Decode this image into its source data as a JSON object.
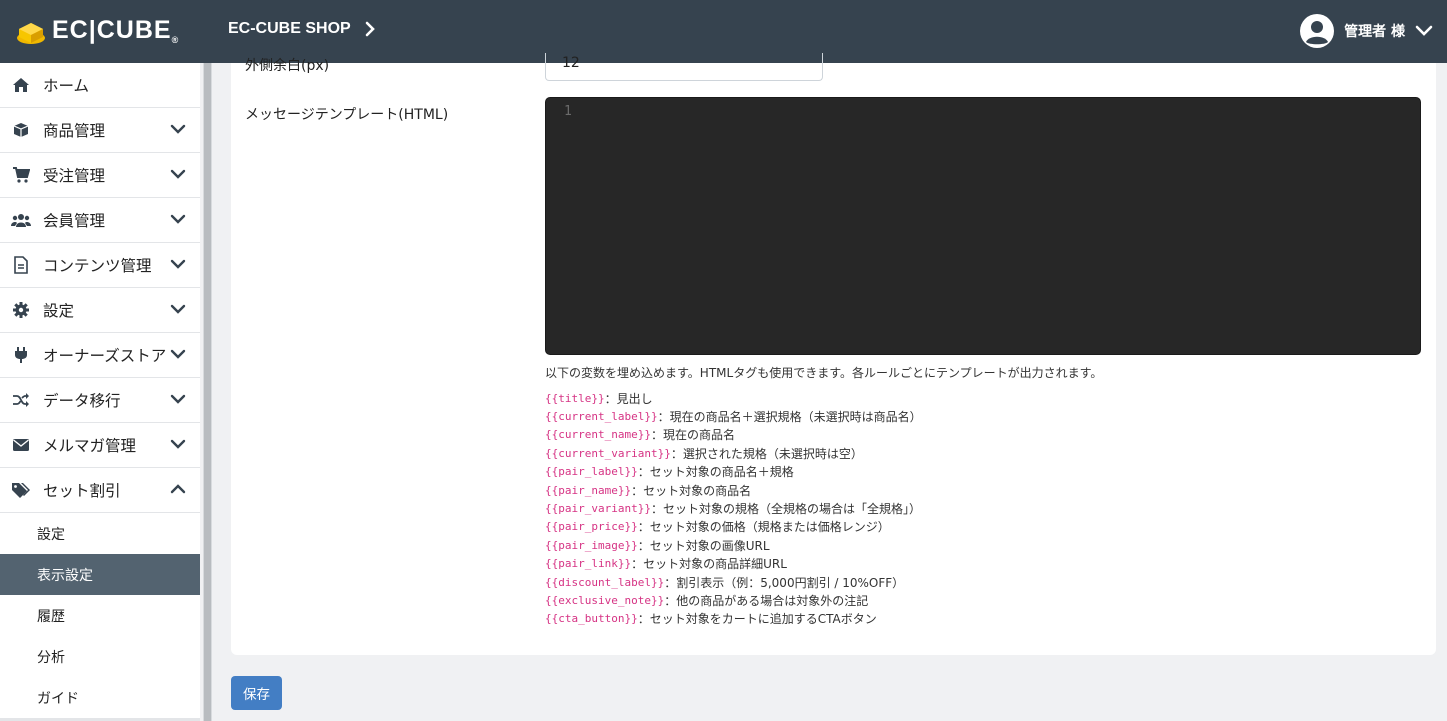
{
  "header": {
    "brand": "EC|CUBE",
    "shop_name": "EC-CUBE SHOP",
    "user_name": "管理者 様"
  },
  "sidebar": {
    "items": [
      {
        "label": "ホーム",
        "icon": "home-icon"
      },
      {
        "label": "商品管理",
        "icon": "cube-icon"
      },
      {
        "label": "受注管理",
        "icon": "cart-icon"
      },
      {
        "label": "会員管理",
        "icon": "users-icon"
      },
      {
        "label": "コンテンツ管理",
        "icon": "file-icon"
      },
      {
        "label": "設定",
        "icon": "gear-icon"
      },
      {
        "label": "オーナーズストア",
        "icon": "plug-icon"
      },
      {
        "label": "データ移行",
        "icon": "shuffle-icon"
      },
      {
        "label": "メルマガ管理",
        "icon": "mail-icon"
      },
      {
        "label": "セット割引",
        "icon": "tags-icon"
      }
    ],
    "sub_items": [
      "設定",
      "表示設定",
      "履歴",
      "分析",
      "ガイド"
    ],
    "active_sub": "表示設定"
  },
  "form": {
    "margin_label": "外側余白(px)",
    "margin_value": "12",
    "template_label": "メッセージテンプレート(HTML)",
    "editor_line_number": "1",
    "help_text": "以下の変数を埋め込めます。HTMLタグも使用できます。各ルールごとにテンプレートが出力されます。",
    "variables": [
      {
        "code": "{{title}}",
        "desc": "：見出し"
      },
      {
        "code": "{{current_label}}",
        "desc": "：現在の商品名＋選択規格（未選択時は商品名）"
      },
      {
        "code": "{{current_name}}",
        "desc": "：現在の商品名"
      },
      {
        "code": "{{current_variant}}",
        "desc": "：選択された規格（未選択時は空）"
      },
      {
        "code": "{{pair_label}}",
        "desc": "：セット対象の商品名＋規格"
      },
      {
        "code": "{{pair_name}}",
        "desc": "：セット対象の商品名"
      },
      {
        "code": "{{pair_variant}}",
        "desc": "：セット対象の規格（全規格の場合は「全規格」）"
      },
      {
        "code": "{{pair_price}}",
        "desc": "：セット対象の価格（規格または価格レンジ）"
      },
      {
        "code": "{{pair_image}}",
        "desc": "：セット対象の画像URL"
      },
      {
        "code": "{{pair_link}}",
        "desc": "：セット対象の商品詳細URL"
      },
      {
        "code": "{{discount_label}}",
        "desc": "：割引表示（例：5,000円割引 / 10%OFF）"
      },
      {
        "code": "{{exclusive_note}}",
        "desc": "：他の商品がある場合は対象外の注記"
      },
      {
        "code": "{{cta_button}}",
        "desc": "：セット対象をカートに追加するCTAボタン"
      }
    ],
    "save_label": "保存"
  },
  "colors": {
    "header_bg": "#36434f",
    "active_bg": "#536370",
    "accent": "#437ec4",
    "code": "#d63384",
    "editor_bg": "#272727"
  }
}
